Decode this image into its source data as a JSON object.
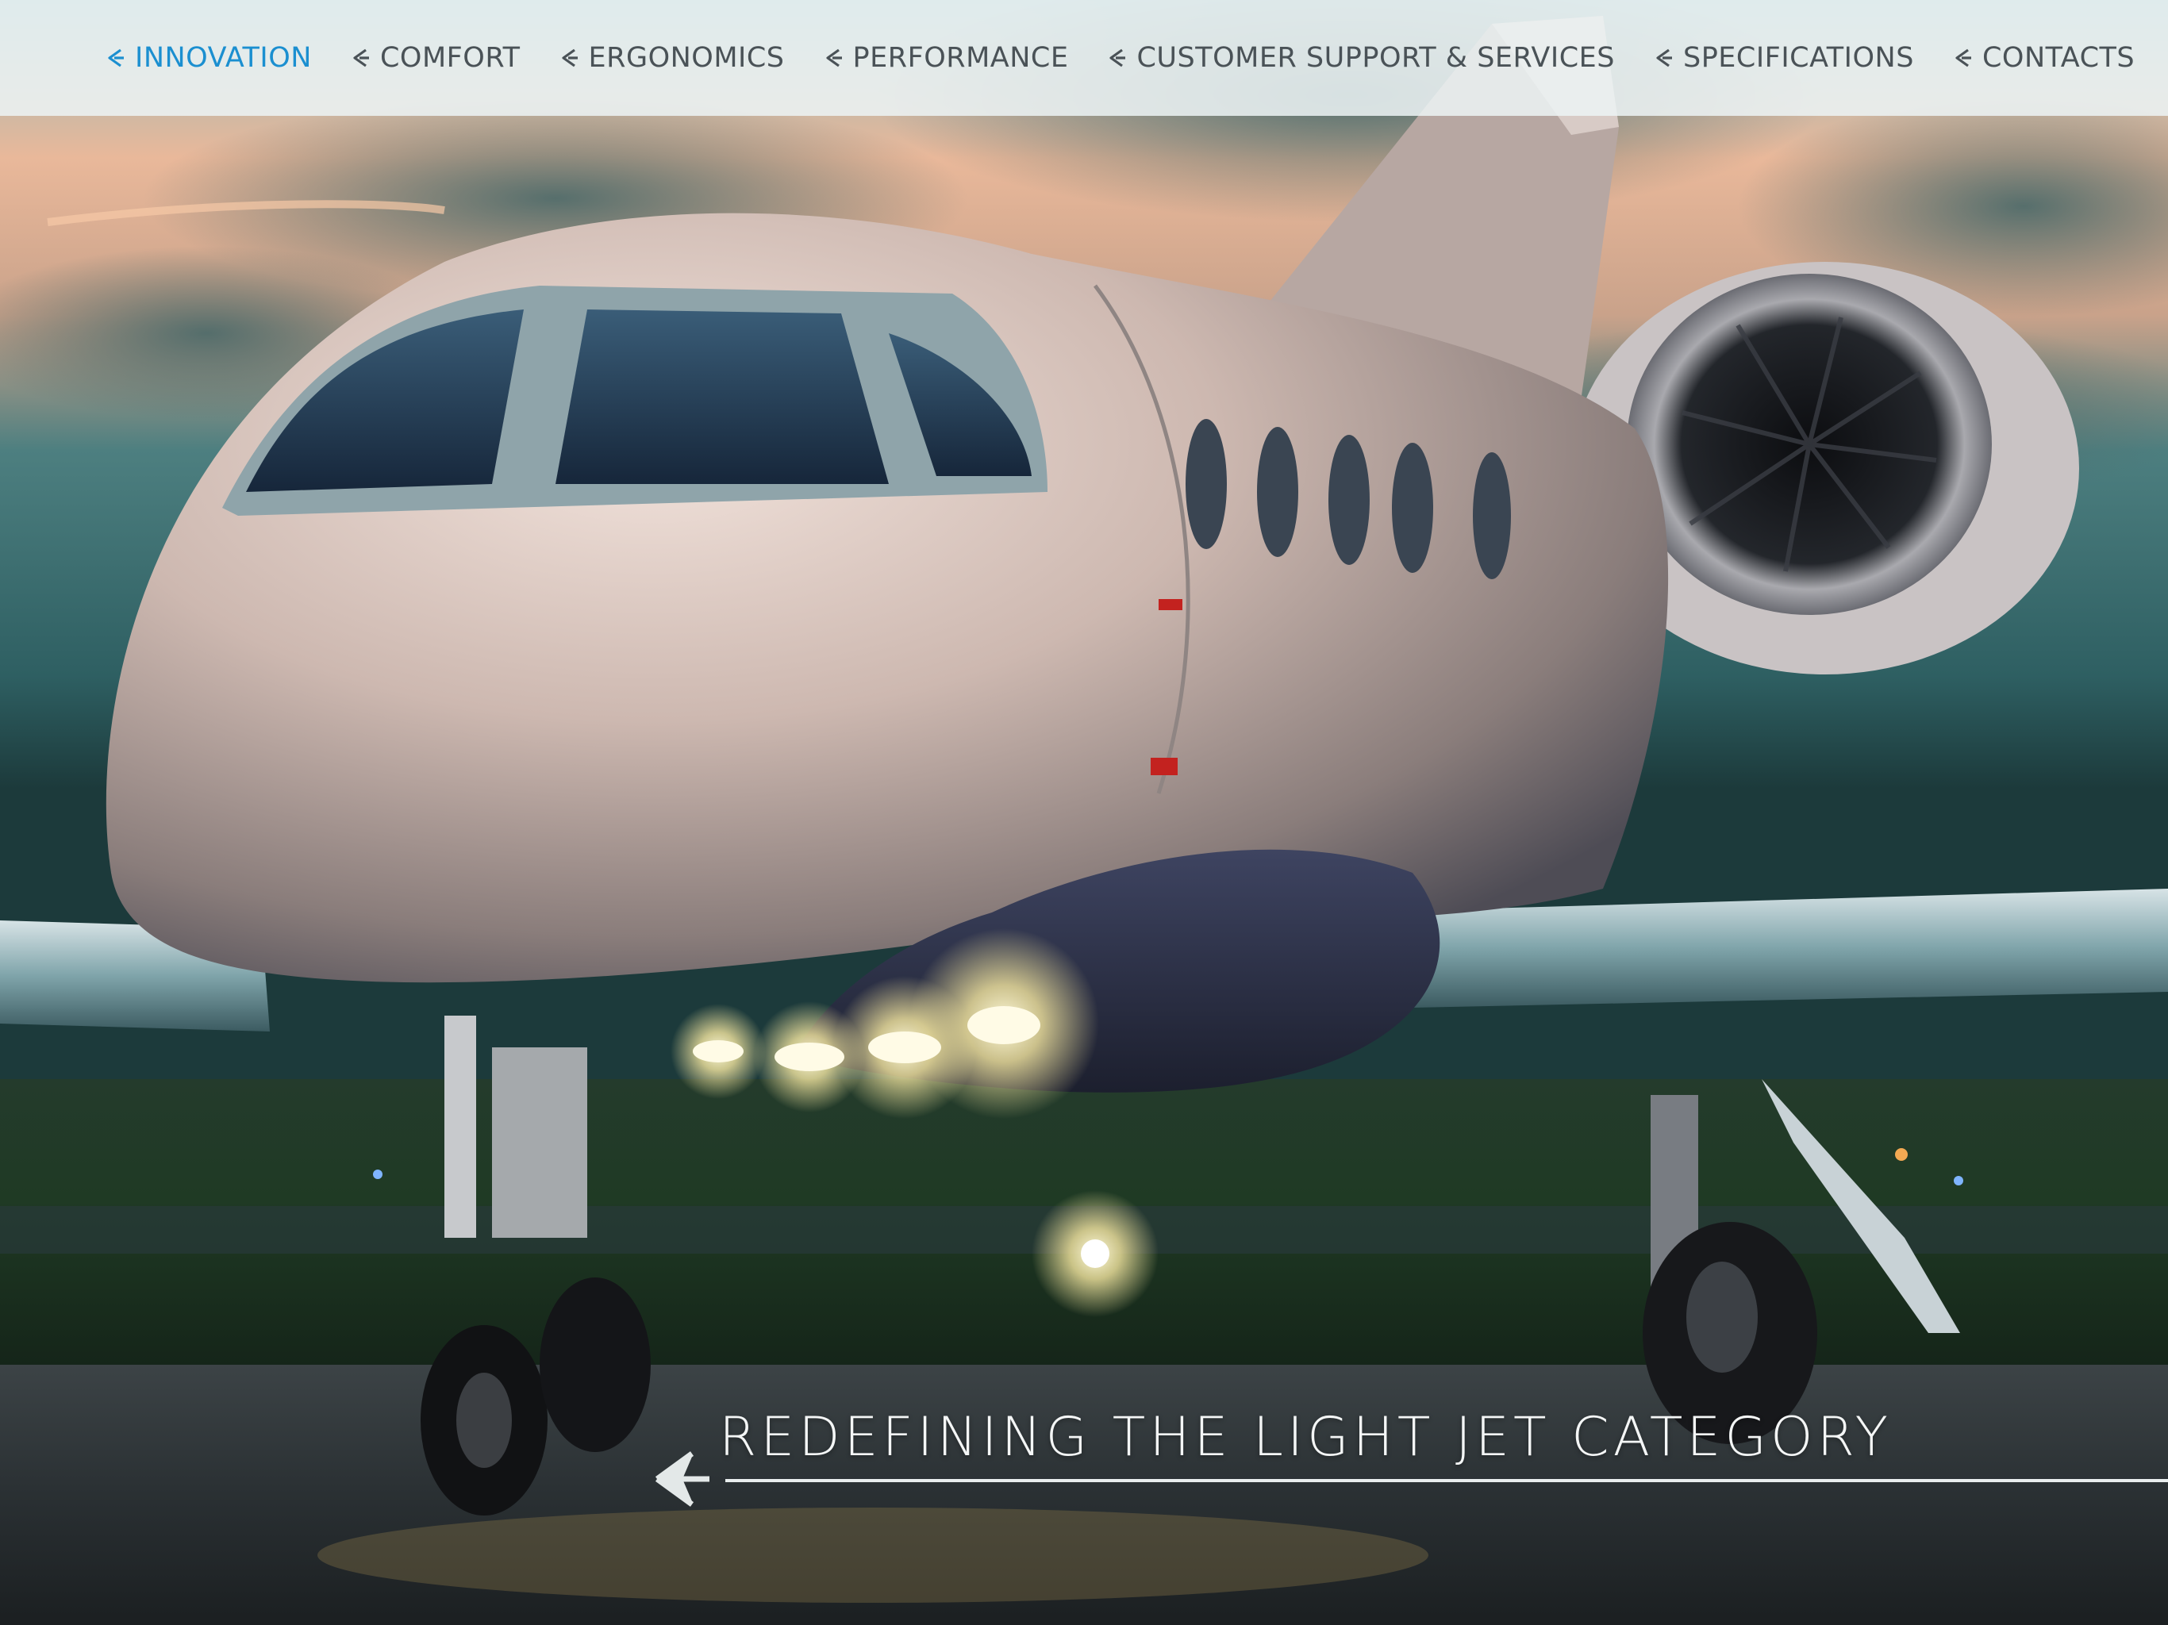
{
  "theme": {
    "accent": "#1b8fd0",
    "nav_text": "#4a5257"
  },
  "nav": {
    "items": [
      {
        "label": "INNOVATION",
        "active": true
      },
      {
        "label": "COMFORT",
        "active": false
      },
      {
        "label": "ERGONOMICS",
        "active": false
      },
      {
        "label": "PERFORMANCE",
        "active": false
      },
      {
        "label": "CUSTOMER SUPPORT & SERVICES",
        "active": false
      },
      {
        "label": "SPECIFICATIONS",
        "active": false
      },
      {
        "label": "CONTACTS",
        "active": false
      }
    ],
    "chevron_icon": "chevron-left-icon"
  },
  "hero": {
    "image_subject": "business jet on runway at dusk",
    "headline": "REDEFINING THE LIGHT JET CATEGORY",
    "back_icon": "arrow-left-icon"
  }
}
